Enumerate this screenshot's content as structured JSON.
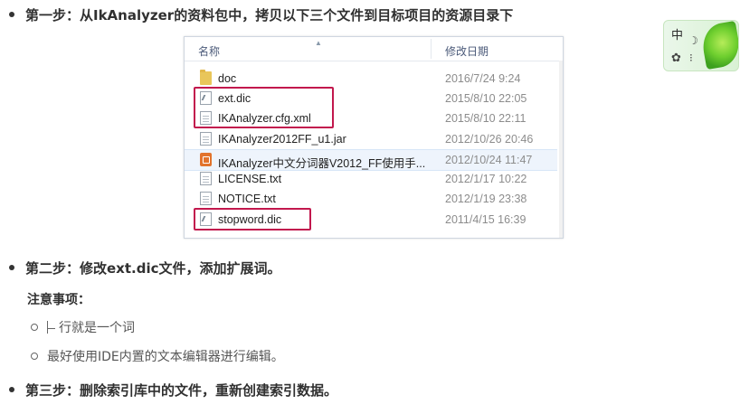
{
  "steps": {
    "step1": "第一步：从IkAnalyzer的资料包中，拷贝以下三个文件到目标项目的资源目录下",
    "step2": "第二步：修改ext.dic文件，添加扩展词。",
    "notes_heading": "注意事项：",
    "note1": "行就是一个词",
    "note2": "最好使用IDE内置的文本编辑器进行编辑。",
    "step3": "第三步：删除索引库中的文件，重新创建索引数据。"
  },
  "explorer": {
    "col_name": "名称",
    "col_date": "修改日期",
    "files": [
      {
        "name": "doc",
        "date": "2016/7/24 9:24",
        "icon": "folder-icon"
      },
      {
        "name": "ext.dic",
        "date": "2015/8/10 22:05",
        "icon": "text-file-icon"
      },
      {
        "name": "IKAnalyzer.cfg.xml",
        "date": "2015/8/10 22:11",
        "icon": "xml-file-icon"
      },
      {
        "name": "IKAnalyzer2012FF_u1.jar",
        "date": "2012/10/26 20:46",
        "icon": "jar-file-icon"
      },
      {
        "name": "IKAnalyzer中文分词器V2012_FF使用手...",
        "date": "2012/10/24 11:47",
        "icon": "pdf-file-icon"
      },
      {
        "name": "LICENSE.txt",
        "date": "2012/1/17 10:22",
        "icon": "text-file-icon"
      },
      {
        "name": "NOTICE.txt",
        "date": "2012/1/19 23:38",
        "icon": "text-file-icon"
      },
      {
        "name": "stopword.dic",
        "date": "2011/4/15 16:39",
        "icon": "text-file-icon"
      }
    ]
  },
  "widget": {
    "char": "中",
    "moon": "☽",
    "gear": "✿",
    "dots": "⁝"
  },
  "colors": {
    "highlight": "#c2184d",
    "leaf": "#6fcf2f"
  }
}
